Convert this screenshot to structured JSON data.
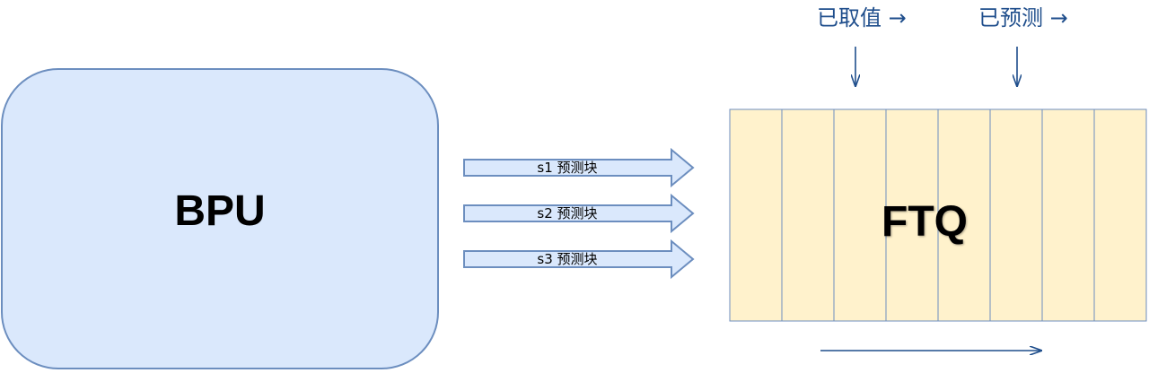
{
  "bpu": {
    "label": "BPU"
  },
  "stages": [
    {
      "label": "s1 预测块"
    },
    {
      "label": "s2 预测块"
    },
    {
      "label": "s3 预测块"
    }
  ],
  "ftq": {
    "label": "FTQ",
    "slot_count": 8
  },
  "pointers": [
    {
      "label": "已取值 →"
    },
    {
      "label": "已预测 →"
    }
  ],
  "colors": {
    "bpu_fill": "#dae8fc",
    "bpu_stroke": "#6c8ebf",
    "ftq_fill": "#fff2cc",
    "ftq_stroke": "#6c8ebf",
    "pointer_text": "#1f4e8c",
    "arrow": "#1f4e8c"
  }
}
